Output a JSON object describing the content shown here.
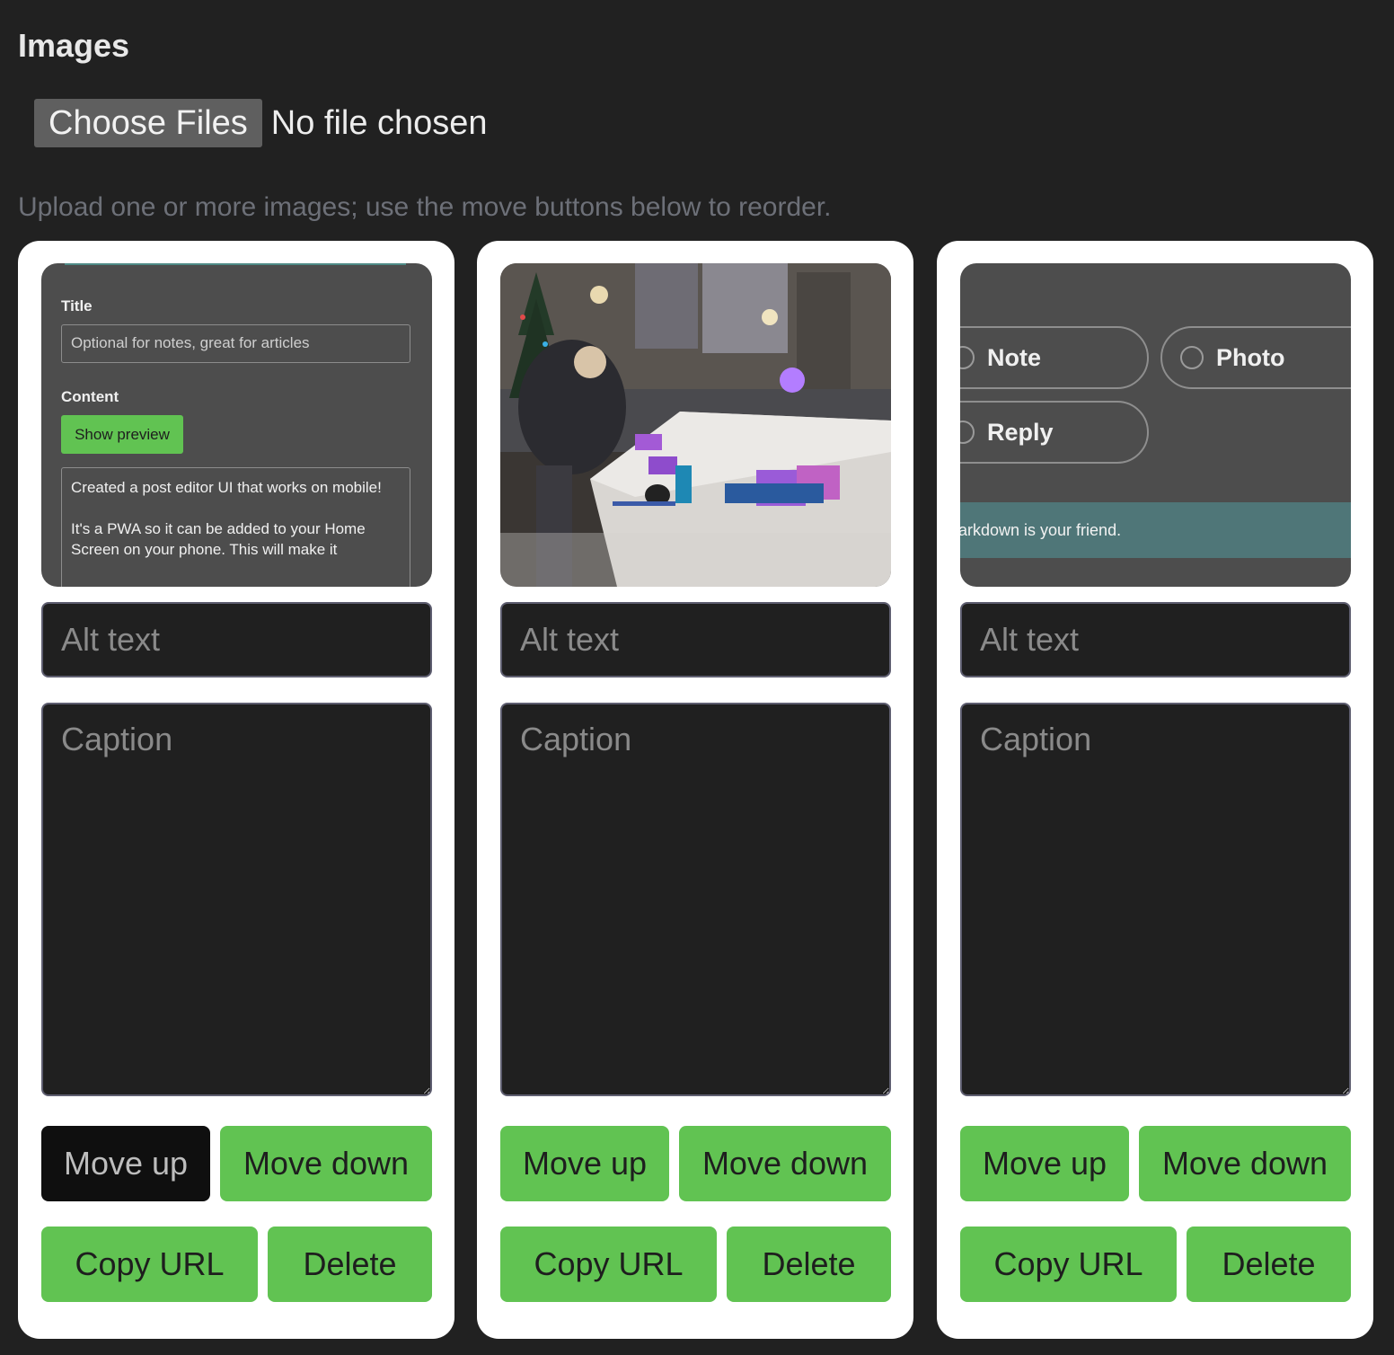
{
  "section": {
    "heading": "Images",
    "file_input": {
      "button_label": "Choose Files",
      "status": "No file chosen"
    },
    "hint": "Upload one or more images; use the move buttons below to reorder."
  },
  "cards": [
    {
      "thumb": {
        "title_label": "Title",
        "title_placeholder": "Optional for notes, great for articles",
        "content_label": "Content",
        "preview_button": "Show preview",
        "content_line1": "Created a post editor UI that works on mobile!",
        "content_line2": "It's a PWA so it can be added to your Home Screen on your phone. This will make it"
      },
      "alt_placeholder": "Alt text",
      "caption_placeholder": "Caption",
      "move_up": "Move up",
      "move_down": "Move down",
      "copy_url": "Copy URL",
      "delete": "Delete"
    },
    {
      "alt_placeholder": "Alt text",
      "caption_placeholder": "Caption",
      "move_up": "Move up",
      "move_down": "Move down",
      "copy_url": "Copy URL",
      "delete": "Delete"
    },
    {
      "thumb": {
        "option_note": "Note",
        "option_photo": "Photo",
        "option_reply": "Reply",
        "banner_text": "arkdown is your friend."
      },
      "alt_placeholder": "Alt text",
      "caption_placeholder": "Caption",
      "move_up": "Move up",
      "move_down": "Move down",
      "copy_url": "Copy URL",
      "delete": "Delete"
    }
  ],
  "colors": {
    "background": "#212121",
    "card": "#ffffff",
    "accent_green": "#61c352",
    "input_bg": "#202020",
    "disabled_button": "#0f0f0f",
    "hint_text": "#6d7078"
  }
}
